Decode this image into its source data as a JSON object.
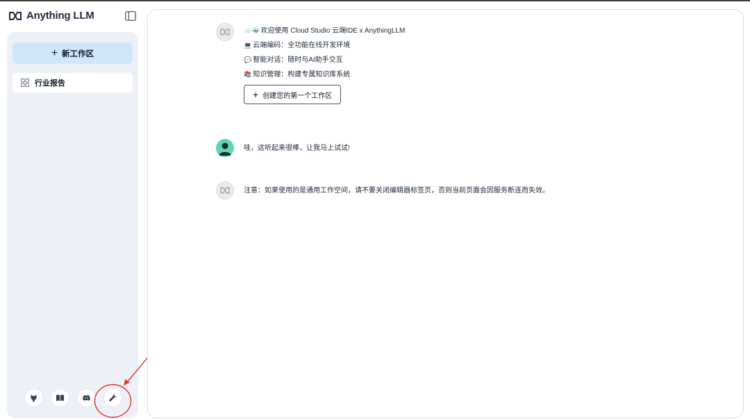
{
  "app": {
    "name": "Anything LLM"
  },
  "sidebar": {
    "new_workspace_label": "新工作区",
    "workspaces": [
      {
        "label": "行业报告"
      }
    ],
    "footer_icons": [
      "github-icon",
      "docs-book-icon",
      "discord-icon",
      "settings-wrench-icon"
    ]
  },
  "chat": {
    "welcome": {
      "title": "欢迎使用 Cloud Studio 云端IDE x AnythingLLM",
      "features": [
        {
          "text": "云端编码：全功能在线开发环境"
        },
        {
          "text": "智能对话：随时与AI助手交互"
        },
        {
          "text": "知识管理：构建专属知识库系统"
        }
      ],
      "create_button": "创建您的第一个工作区"
    },
    "user_message": "哇，这听起来很棒，让我马上试试!",
    "notice": "注意：如果使用的是通用工作空间，请不要关闭编辑器标签页，否则当前页面会因服务断连而失效。"
  },
  "colors": {
    "accent": "#cfe6fb",
    "sidebar_bg": "#edf1f7",
    "annotation": "#e0322b",
    "user_avatar": "#5ed6b3"
  }
}
